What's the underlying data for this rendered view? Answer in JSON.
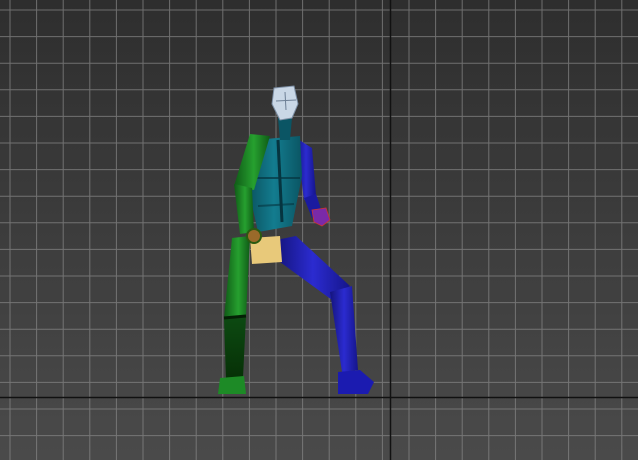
{
  "viewport": {
    "kind": "3d-perspective-viewport",
    "background_top": "#2e2e2e",
    "background_bottom": "#4a4a4a",
    "grid_color": "#8a8a8a",
    "axis_color": "#111111",
    "grid_visible": true
  },
  "figure": {
    "kind": "biped-rig",
    "pose": "walking",
    "colors": {
      "head": "#c9d7e6",
      "torso": "#0f6f80",
      "left_side": "#1e7f2a",
      "right_side": "#1f1faa",
      "pelvis": "#e8c97a",
      "hand_left": "#9a6a2a",
      "hand_right": "#7a2aa8"
    }
  }
}
